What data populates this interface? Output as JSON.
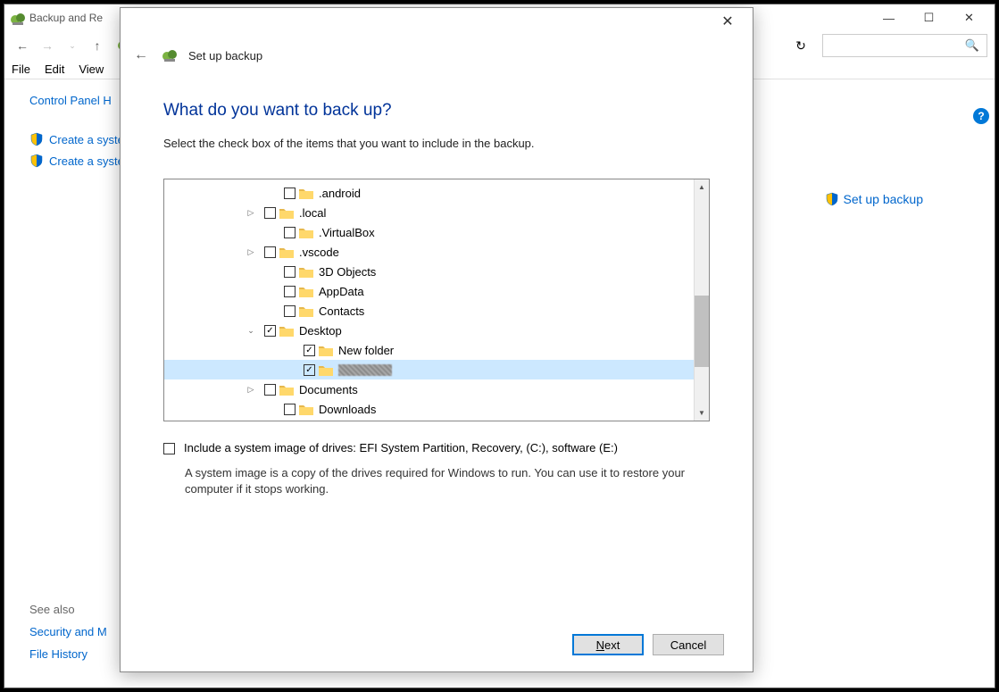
{
  "titlebar": {
    "title": "Backup and Re"
  },
  "menu": {
    "file": "File",
    "edit": "Edit",
    "view": "View"
  },
  "sidebar": {
    "home": "Control Panel H",
    "create1": "Create a system",
    "create2": "Create a system"
  },
  "main_link": {
    "set_up": "Set up backup"
  },
  "see_also": {
    "heading": "See also",
    "security": "Security and M",
    "history": "File History"
  },
  "dialog": {
    "title": "Set up backup",
    "heading": "What do you want to back up?",
    "subtitle": "Select the check box of the items that you want to include in the backup.",
    "tree": [
      {
        "indent": 4,
        "chevron": "",
        "checked": false,
        "label": ".android"
      },
      {
        "indent": 3,
        "chevron": ">",
        "checked": false,
        "label": ".local"
      },
      {
        "indent": 4,
        "chevron": "",
        "checked": false,
        "label": ".VirtualBox"
      },
      {
        "indent": 3,
        "chevron": ">",
        "checked": false,
        "label": ".vscode"
      },
      {
        "indent": 4,
        "chevron": "",
        "checked": false,
        "label": "3D Objects"
      },
      {
        "indent": 4,
        "chevron": "",
        "checked": false,
        "label": "AppData"
      },
      {
        "indent": 4,
        "chevron": "",
        "checked": false,
        "label": "Contacts"
      },
      {
        "indent": 3,
        "chevron": "v",
        "checked": true,
        "label": "Desktop"
      },
      {
        "indent": 5,
        "chevron": "",
        "checked": true,
        "label": "New folder"
      },
      {
        "indent": 5,
        "chevron": "",
        "checked": true,
        "label": "",
        "redacted": true,
        "selected": true
      },
      {
        "indent": 3,
        "chevron": ">",
        "checked": false,
        "label": "Documents"
      },
      {
        "indent": 4,
        "chevron": "",
        "checked": false,
        "label": "Downloads"
      }
    ],
    "sysimg_label": "Include a system image of drives: EFI System Partition, Recovery, (C:), software (E:)",
    "sysimg_desc": "A system image is a copy of the drives required for Windows to run. You can use it to restore your computer if it stops working.",
    "next": "Next",
    "cancel": "Cancel"
  }
}
